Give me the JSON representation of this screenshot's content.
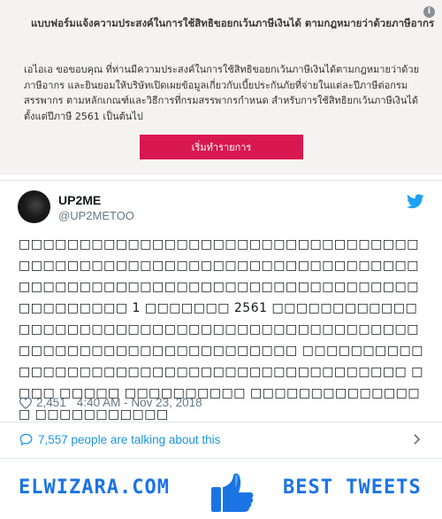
{
  "promo": {
    "title": "แบบฟอร์มแจ้งความประสงค์ในการใช้สิทธิขอยกเว้นภาษีเงินได้  ตามกฎหมายว่าด้วยภาษีอากร",
    "body": "เอไอเอ ขอขอบคุณ ที่ท่านมีความประสงค์ในการใช้สิทธิขอยกเว้นภาษีเงินได้ตามกฎหมายว่าด้วย\nภาษีอากร และยินยอมให้บริษัทเปิดเผยข้อมูลเกี่ยวกับเบี้ยประกันภัยที่จ่ายในแต่ละปีภาษีต่อกรม\nสรรพากร ตามหลักเกณฑ์และวิธีการที่กรมสรรพากรกำหนด สำหรับการใช้สิทธิยกเว้นภาษีเงินได้\nตั้งแต่ปีภาษี 2561 เป็นต้นไป",
    "button_label": "เริ่มทำรายการ",
    "info_icon": "i",
    "button_color": "#d9184f"
  },
  "tweet": {
    "display_name": "UP2ME",
    "handle": "@UP2METOO",
    "text": "□□□□□□□□□□□□□□□□□□□□□□□□□□□□□□□□□□□□□□□□□□□□□□□□□□□□□□□□□□□□□□□□□□□□□□□□□□□□□□□□□□□□□□□□□□□□□□□□□□□□□□□□□□□□ 1 □□□□□□□ 2561 □□□□□□□□□□□□□□□□□□□□□□□□□□□□□□□□□□□□□□□□□□□□□□□□□□□□□□□□□□□□□□□□□□□□ □□□□□□□□□□□□□□□□□□□□□□□□□□□□□□□□□□□□□□□□□□ □□□□ □□□□□ □□□□□□□□□□ □□□□□□□□□□□□□□□ □□□□□□□□□□□",
    "likes": "2,451",
    "timestamp": "4:40 AM - Nov 23, 2018",
    "talking": "7,557 people are talking about this",
    "accent_color": "#1b95e0"
  },
  "footer": {
    "left_brand": "ELWIZARA.COM",
    "right_brand": "BEST TWEETS",
    "brand_color": "#1b74e4"
  }
}
